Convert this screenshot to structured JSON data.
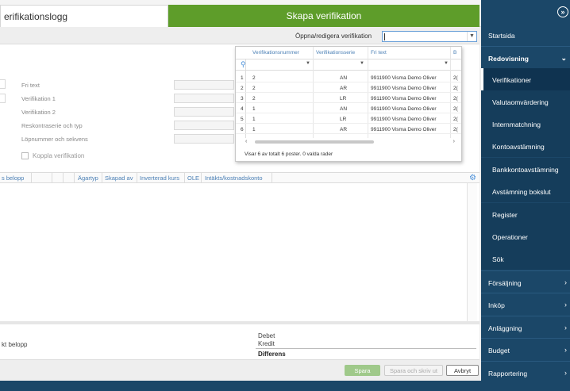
{
  "tabs": {
    "log": "erifikationslogg",
    "create": "Skapa verifikation"
  },
  "toolbar": {
    "open_label": "Öppna/redigera verifikation",
    "open_value": ""
  },
  "form": {
    "fields": [
      "Fri text",
      "Verifikation 1",
      "Verifikation 2",
      "Reskontraserie och typ",
      "Löpnummer och sekvens"
    ],
    "checkbox_label": "Koppla verifikation"
  },
  "grid": {
    "columns": [
      "s belopp",
      "Ägartyp",
      "Skapad av",
      "Inverterad kurs",
      "OLE",
      "Intäkts/kostnadskonto"
    ]
  },
  "popup": {
    "columns": [
      "Verifikationsnummer",
      "Verifikationsserie",
      "Fri text",
      "B"
    ],
    "rows": [
      {
        "n": "1",
        "num": "2",
        "serie": "AN",
        "text": "9911900 Visma Demo Oliver",
        "b": "2("
      },
      {
        "n": "2",
        "num": "2",
        "serie": "AR",
        "text": "9911900 Visma Demo Oliver",
        "b": "2("
      },
      {
        "n": "3",
        "num": "2",
        "serie": "LR",
        "text": "9911900 Visma Demo Oliver",
        "b": "2("
      },
      {
        "n": "4",
        "num": "1",
        "serie": "AN",
        "text": "9911900 Visma Demo Oliver",
        "b": "2("
      },
      {
        "n": "5",
        "num": "1",
        "serie": "LR",
        "text": "9911900 Visma Demo Oliver",
        "b": "2("
      },
      {
        "n": "6",
        "num": "1",
        "serie": "AR",
        "text": "9911900 Visma Demo Oliver",
        "b": "2("
      }
    ],
    "status": "Visar 6 av totalt 6 poster. 0 valda rader"
  },
  "summary": {
    "amount_label": "kt belopp",
    "debet": "Debet",
    "kredit": "Kredit",
    "diff": "Differens"
  },
  "buttons": {
    "save": "Spara",
    "save_print": "Spara och skriv ut",
    "cancel": "Avbryt"
  },
  "sidebar": {
    "collapse": "»",
    "items": [
      {
        "label": "Startsida"
      },
      {
        "label": "Redovisning"
      },
      {
        "label": "Verifikationer"
      },
      {
        "label": "Valutaomvärdering"
      },
      {
        "label": "Internmatchning"
      },
      {
        "label": "Kontoavstämning"
      },
      {
        "label": "Bankkontoavstämning"
      },
      {
        "label": "Avstämning bokslut"
      },
      {
        "label": "Register"
      },
      {
        "label": "Operationer"
      },
      {
        "label": "Sök"
      },
      {
        "label": "Försäljning"
      },
      {
        "label": "Inköp"
      },
      {
        "label": "Anläggning"
      },
      {
        "label": "Budget"
      },
      {
        "label": "Rapportering"
      }
    ]
  },
  "colors": {
    "sidebar_bg": "#1b4768",
    "primary_green": "#5e9d2a",
    "link_blue": "#4a7fb5"
  }
}
